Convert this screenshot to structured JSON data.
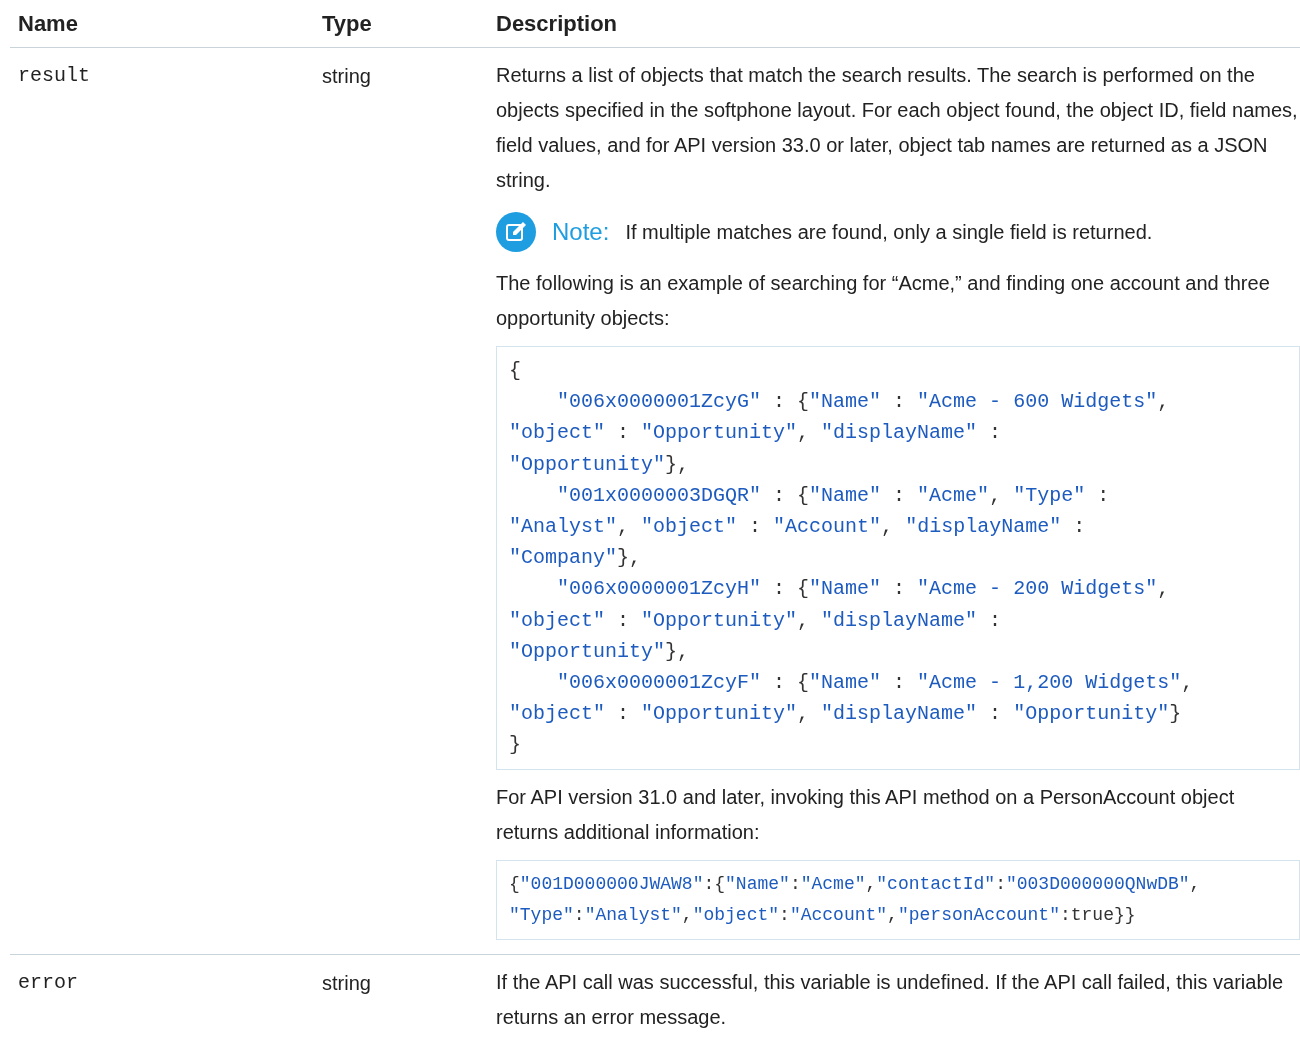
{
  "columns": [
    "Name",
    "Type",
    "Description"
  ],
  "rows": [
    {
      "name": "result",
      "type": "string",
      "description": [
        {
          "kind": "paragraph",
          "text": "Returns a list of objects that match the search results. The search is performed on the objects specified in the softphone layout. For each object found, the object ID, field names, field values, and for API version 33.0 or later, object tab names are returned as a JSON string."
        },
        {
          "kind": "note",
          "label": "Note:",
          "text": "If multiple matches are found, only a single field is returned."
        },
        {
          "kind": "paragraph",
          "text": "The following is an example of searching for “Acme,” and finding one account and three opportunity objects:"
        },
        {
          "kind": "code",
          "lines": [
            "{",
            "    \"006x0000001ZcyG\" : {\"Name\" : \"Acme - 600 Widgets\",",
            "\"object\" : \"Opportunity\", \"displayName\" :",
            "\"Opportunity\"},",
            "    \"001x0000003DGQR\" : {\"Name\" : \"Acme\", \"Type\" :",
            "\"Analyst\", \"object\" : \"Account\", \"displayName\" :",
            "\"Company\"},",
            "    \"006x0000001ZcyH\" : {\"Name\" : \"Acme - 200 Widgets\",",
            "\"object\" : \"Opportunity\", \"displayName\" :",
            "\"Opportunity\"},",
            "    \"006x0000001ZcyF\" : {\"Name\" : \"Acme - 1,200 Widgets\",",
            "\"object\" : \"Opportunity\", \"displayName\" : \"Opportunity\"}",
            "}"
          ]
        },
        {
          "kind": "paragraph",
          "text": "For API version 31.0 and later, invoking this API method on a PersonAccount object returns additional information:"
        },
        {
          "kind": "snippet",
          "lines": [
            "{\"001D000000JWAW8\":{\"Name\":\"Acme\",\"contactId\":\"003D000000QNwDB\",",
            "\"Type\":\"Analyst\",\"object\":\"Account\",\"personAccount\":true}}"
          ]
        }
      ]
    },
    {
      "name": "error",
      "type": "string",
      "description": [
        {
          "kind": "paragraph",
          "text": "If the API call was successful, this variable is undefined. If the API call failed, this variable returns an error message."
        }
      ]
    }
  ]
}
